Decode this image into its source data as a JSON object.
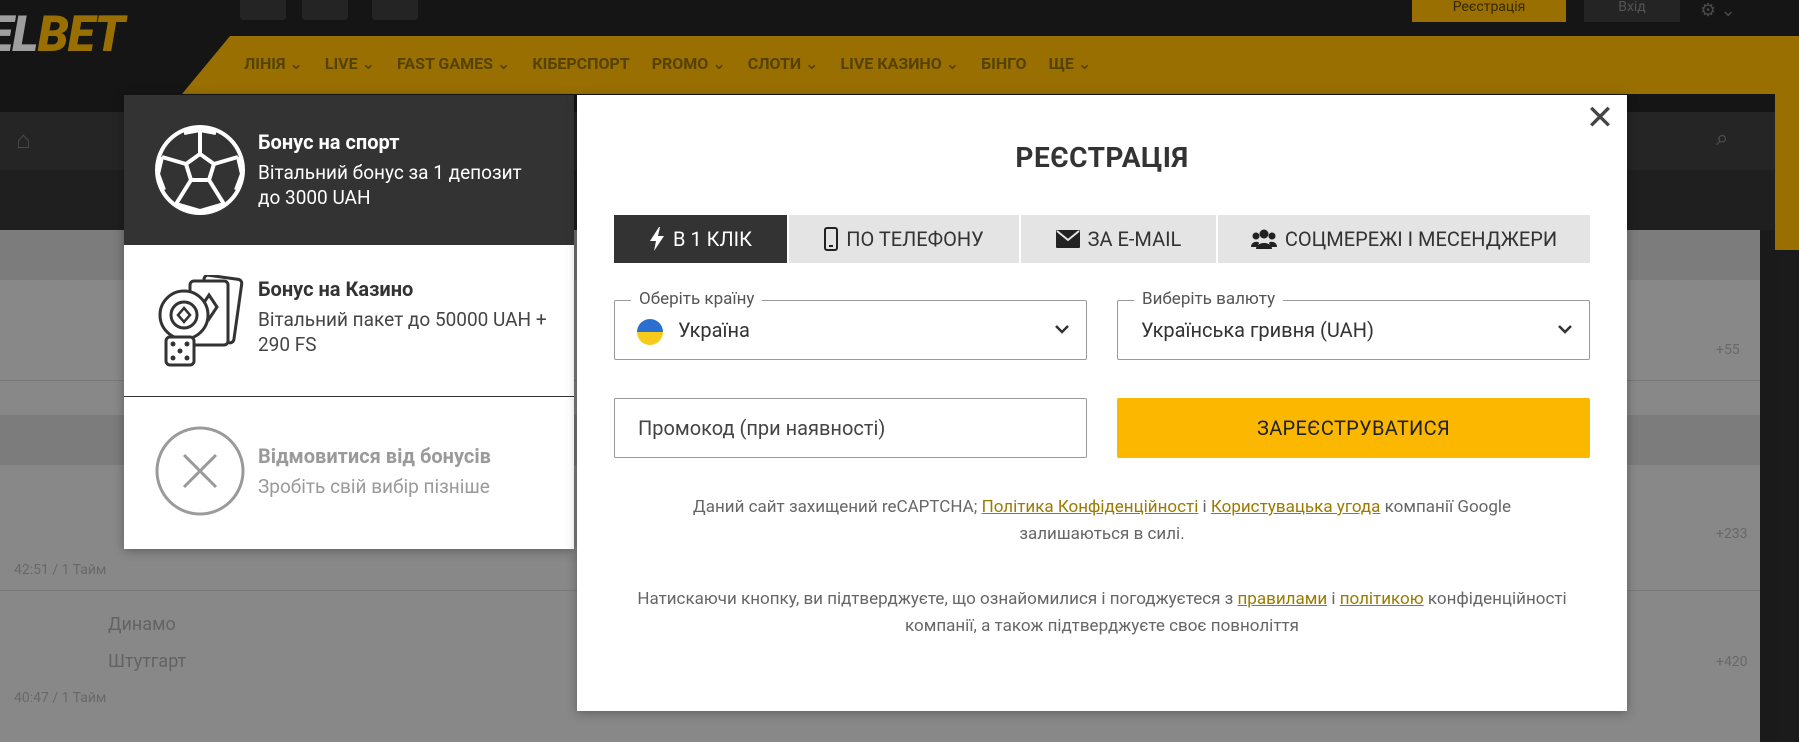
{
  "background": {
    "logo_left": "EL",
    "logo_right": "BET",
    "register_label": "Реєстрація",
    "login_label": "Вхід",
    "nav": [
      "ЛІНІЯ ⌄",
      "LIVE ⌄",
      "FAST GAMES ⌄",
      "КІБЕРСПОРТ",
      "PROMO ⌄",
      "СЛОТИ ⌄",
      "LIVE КАЗИНО ⌄",
      "БІНГО",
      "ЩЕ ⌄"
    ],
    "teams": [
      "Динамо",
      "Штутгарт"
    ],
    "row_meta": [
      "40:47 / 1 Тайм",
      "42:51 / 1 Тайм"
    ],
    "odds": [
      "+55",
      "+233",
      "+420"
    ]
  },
  "bonuses": {
    "sport": {
      "title": "Бонус на спорт",
      "desc": "Вітальний бонус за 1 депозит до 3000 UAH",
      "icon": "soccer-ball-icon"
    },
    "casino": {
      "title": "Бонус на Казино",
      "desc": "Вітальний пакет до 50000 UAH + 290 FS",
      "icon": "casino-chips-cards-dice-icon"
    },
    "refuse": {
      "title": "Відмовитися від бонусів",
      "desc": "Зробіть свій вибір пізніше",
      "icon": "close-circle-icon"
    }
  },
  "modal": {
    "title": "РЕЄСТРАЦІЯ",
    "tabs": [
      {
        "label": "В 1 КЛІК",
        "icon": "lightning-icon"
      },
      {
        "label": "ПО ТЕЛЕФОНУ",
        "icon": "phone-icon"
      },
      {
        "label": "ЗА E-MAIL",
        "icon": "envelope-icon"
      },
      {
        "label": "СОЦМЕРЕЖІ І МЕСЕНДЖЕРИ",
        "icon": "users-icon"
      }
    ],
    "country": {
      "legend": "Оберіть країну",
      "value": "Україна"
    },
    "currency": {
      "legend": "Виберіть валюту",
      "value": "Українська гривня (UAH)"
    },
    "promo_placeholder": "Промокод (при наявності)",
    "submit_label": "ЗАРЕЄСТРУВАТИСЯ",
    "captcha": {
      "prefix": "Даний сайт захищений reCAPTCHA; ",
      "privacy_link": "Політика Конфіденційності",
      "and": " і ",
      "terms_link": "Користувацька угода",
      "suffix": " компанії Google залишаються в силі."
    },
    "consent": {
      "prefix": "Натискаючи кнопку, ви підтверджуєте, що ознайомилися і погоджуєтеся з ",
      "rules_link": "правилами",
      "and": " і ",
      "policy_link": "політикою",
      "suffix": " конфіденційності компанії, а також підтверджуєте своє повноліття"
    }
  },
  "colors": {
    "accent": "#FCB800",
    "dark": "#333333",
    "link": "#9A7A00"
  }
}
